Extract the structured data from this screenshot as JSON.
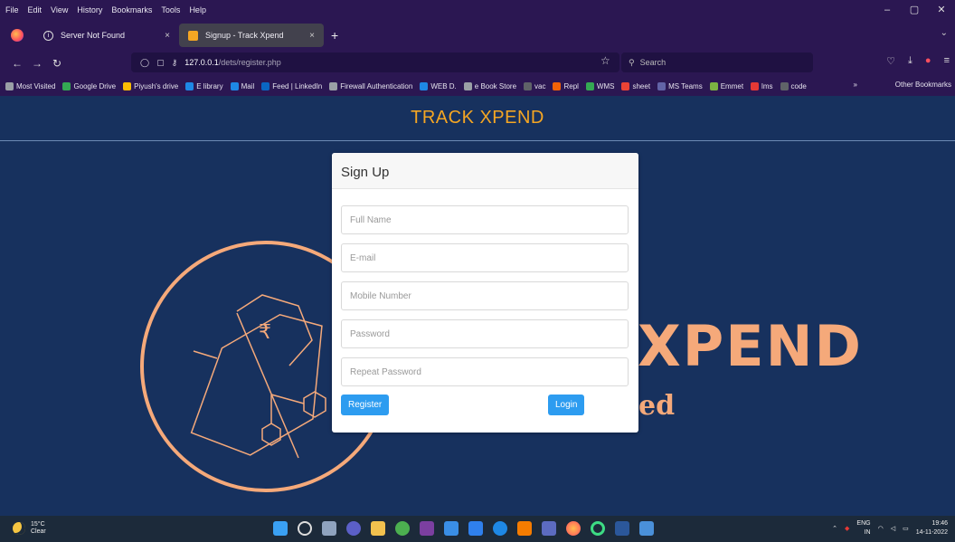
{
  "menubar": {
    "items": [
      "File",
      "Edit",
      "View",
      "History",
      "Bookmarks",
      "Tools",
      "Help"
    ]
  },
  "window_controls": [
    "–",
    "▢",
    "✕"
  ],
  "tabs": [
    {
      "title": "Server Not Found",
      "close": "×"
    },
    {
      "title": "Signup - Track Xpend",
      "close": "×"
    }
  ],
  "newtab_label": "+",
  "nav": {
    "url_host": "127.0.0.1",
    "url_path": "/dets/register.php",
    "search_placeholder": "Search"
  },
  "bookmarks": [
    {
      "label": "Most Visited",
      "color": "#9aa0a6"
    },
    {
      "label": "Google Drive",
      "color": "#34a853"
    },
    {
      "label": "Piyush's drive",
      "color": "#fbbc04"
    },
    {
      "label": "E library",
      "color": "#1e88e5"
    },
    {
      "label": "Mail",
      "color": "#1e88e5"
    },
    {
      "label": "Feed | LinkedIn",
      "color": "#0a66c2"
    },
    {
      "label": "Firewall Authentication",
      "color": "#9aa0a6"
    },
    {
      "label": "WEB D.",
      "color": "#1e88e5"
    },
    {
      "label": "e Book Store",
      "color": "#9aa0a6"
    },
    {
      "label": "vac",
      "color": "#5f6368"
    },
    {
      "label": "Repl",
      "color": "#f26207"
    },
    {
      "label": "WMS",
      "color": "#34a853"
    },
    {
      "label": "sheet",
      "color": "#ea4335"
    },
    {
      "label": "MS Teams",
      "color": "#6264a7"
    },
    {
      "label": "Emmet",
      "color": "#7cb342"
    },
    {
      "label": "lms",
      "color": "#e53935"
    },
    {
      "label": "code",
      "color": "#5f6368"
    }
  ],
  "bookmarks_more": "»",
  "bookmarks_other": "Other Bookmarks",
  "site": {
    "title": "TRACK XPEND",
    "bg_word": "XPEND",
    "bg_word2": "ed"
  },
  "signup": {
    "heading": "Sign Up",
    "fields": {
      "full_name": "Full Name",
      "email": "E-mail",
      "mobile": "Mobile Number",
      "password": "Password",
      "repeat_password": "Repeat Password"
    },
    "register_label": "Register",
    "login_label": "Login"
  },
  "taskbar": {
    "temp": "15°C",
    "weather": "Clear",
    "lang1": "ENG",
    "lang2": "IN",
    "time": "19:46",
    "date": "14-11-2022"
  },
  "colors": {
    "accent": "#f5a623",
    "page_bg": "#17315e",
    "art": "#f5a97a",
    "button": "#2d9cf0"
  }
}
